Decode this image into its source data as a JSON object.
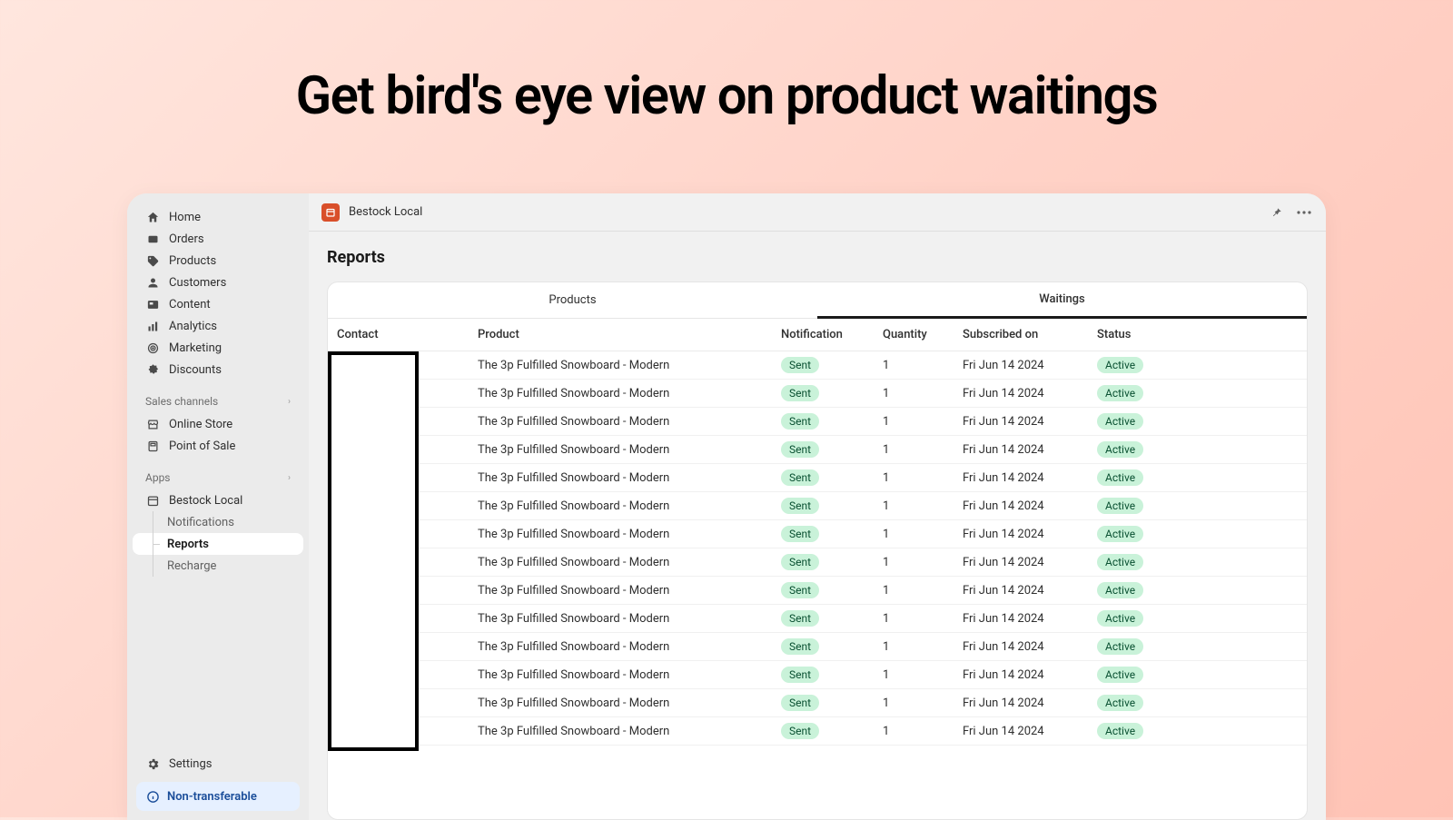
{
  "hero": "Get bird's eye view on product waitings",
  "sidebar": {
    "nav": [
      {
        "label": "Home",
        "icon": "home"
      },
      {
        "label": "Orders",
        "icon": "orders"
      },
      {
        "label": "Products",
        "icon": "products"
      },
      {
        "label": "Customers",
        "icon": "customers"
      },
      {
        "label": "Content",
        "icon": "content"
      },
      {
        "label": "Analytics",
        "icon": "analytics"
      },
      {
        "label": "Marketing",
        "icon": "marketing"
      },
      {
        "label": "Discounts",
        "icon": "discounts"
      }
    ],
    "sections": {
      "sales": {
        "title": "Sales channels",
        "items": [
          {
            "label": "Online Store",
            "icon": "store"
          },
          {
            "label": "Point of Sale",
            "icon": "pos"
          }
        ]
      },
      "apps": {
        "title": "Apps",
        "items": [
          {
            "label": "Bestock Local",
            "icon": "app",
            "children": [
              {
                "label": "Notifications"
              },
              {
                "label": "Reports",
                "active": true
              },
              {
                "label": "Recharge"
              }
            ]
          }
        ]
      }
    },
    "settings_label": "Settings",
    "banner": "Non-transferable"
  },
  "topbar": {
    "app_name": "Bestock Local"
  },
  "page": {
    "title": "Reports",
    "tabs": {
      "products": "Products",
      "waitings": "Waitings"
    },
    "columns": {
      "contact": "Contact",
      "product": "Product",
      "notification": "Notification",
      "quantity": "Quantity",
      "subscribed": "Subscribed on",
      "status": "Status"
    },
    "badges": {
      "sent": "Sent",
      "active": "Active"
    },
    "rows": [
      {
        "product": "The 3p Fulfilled Snowboard - Modern",
        "notification": "Sent",
        "quantity": "1",
        "subscribed": "Fri Jun 14 2024",
        "status": "Active"
      },
      {
        "product": "The 3p Fulfilled Snowboard - Modern",
        "notification": "Sent",
        "quantity": "1",
        "subscribed": "Fri Jun 14 2024",
        "status": "Active"
      },
      {
        "product": "The 3p Fulfilled Snowboard - Modern",
        "notification": "Sent",
        "quantity": "1",
        "subscribed": "Fri Jun 14 2024",
        "status": "Active"
      },
      {
        "product": "The 3p Fulfilled Snowboard - Modern",
        "notification": "Sent",
        "quantity": "1",
        "subscribed": "Fri Jun 14 2024",
        "status": "Active"
      },
      {
        "product": "The 3p Fulfilled Snowboard - Modern",
        "notification": "Sent",
        "quantity": "1",
        "subscribed": "Fri Jun 14 2024",
        "status": "Active"
      },
      {
        "product": "The 3p Fulfilled Snowboard - Modern",
        "notification": "Sent",
        "quantity": "1",
        "subscribed": "Fri Jun 14 2024",
        "status": "Active"
      },
      {
        "product": "The 3p Fulfilled Snowboard - Modern",
        "notification": "Sent",
        "quantity": "1",
        "subscribed": "Fri Jun 14 2024",
        "status": "Active"
      },
      {
        "product": "The 3p Fulfilled Snowboard - Modern",
        "notification": "Sent",
        "quantity": "1",
        "subscribed": "Fri Jun 14 2024",
        "status": "Active"
      },
      {
        "product": "The 3p Fulfilled Snowboard - Modern",
        "notification": "Sent",
        "quantity": "1",
        "subscribed": "Fri Jun 14 2024",
        "status": "Active"
      },
      {
        "product": "The 3p Fulfilled Snowboard - Modern",
        "notification": "Sent",
        "quantity": "1",
        "subscribed": "Fri Jun 14 2024",
        "status": "Active"
      },
      {
        "product": "The 3p Fulfilled Snowboard - Modern",
        "notification": "Sent",
        "quantity": "1",
        "subscribed": "Fri Jun 14 2024",
        "status": "Active"
      },
      {
        "product": "The 3p Fulfilled Snowboard - Modern",
        "notification": "Sent",
        "quantity": "1",
        "subscribed": "Fri Jun 14 2024",
        "status": "Active"
      },
      {
        "product": "The 3p Fulfilled Snowboard - Modern",
        "notification": "Sent",
        "quantity": "1",
        "subscribed": "Fri Jun 14 2024",
        "status": "Active"
      },
      {
        "product": "The 3p Fulfilled Snowboard - Modern",
        "notification": "Sent",
        "quantity": "1",
        "subscribed": "Fri Jun 14 2024",
        "status": "Active"
      }
    ]
  }
}
